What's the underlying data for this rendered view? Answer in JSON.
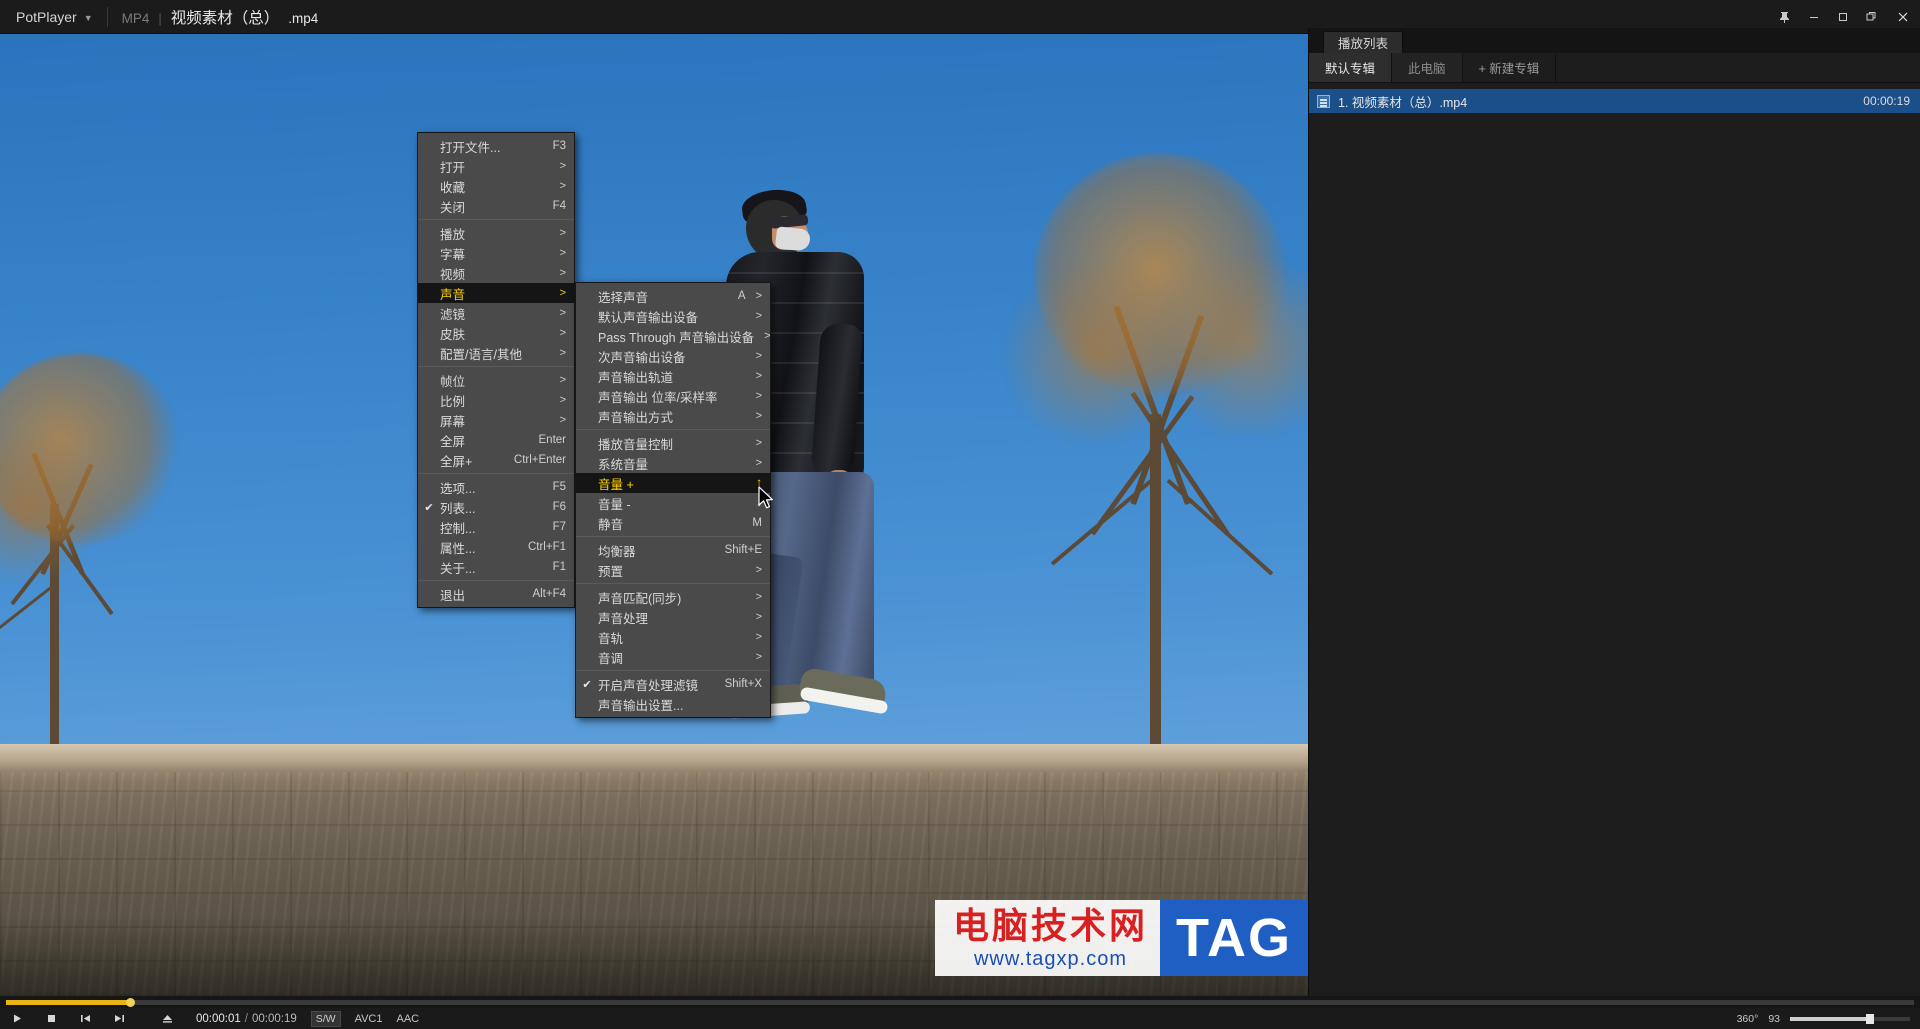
{
  "titlebar": {
    "brand": "PotPlayer",
    "caret_icon": "chevron-down-icon",
    "format": "MP4",
    "divider": "|",
    "filename": "视频素材（总）",
    "extension": ".mp4",
    "buttons": [
      {
        "name": "pin-on-top-button",
        "glyph": "pin"
      },
      {
        "name": "minimize-button",
        "glyph": "minimize"
      },
      {
        "name": "maximize-button",
        "glyph": "maximize"
      },
      {
        "name": "restore-button",
        "glyph": "restore"
      },
      {
        "name": "close-button",
        "glyph": "close"
      }
    ]
  },
  "playlist": {
    "tab": "播放列表",
    "subtabs": [
      {
        "label": "默认专辑",
        "active": true
      },
      {
        "label": "此电脑",
        "active": false
      },
      {
        "label": "+ 新建专辑",
        "active": false
      }
    ],
    "items": [
      {
        "index_title": "1. 视频素材（总）.mp4",
        "duration": "00:00:19",
        "icon": "video-file-icon"
      }
    ]
  },
  "menu_main": {
    "name": "main-context-menu",
    "items": [
      {
        "label": "打开文件...",
        "accel": "F3",
        "arrow": false,
        "checked": false,
        "highlight": false
      },
      {
        "label": "打开",
        "accel": "",
        "arrow": true,
        "checked": false,
        "highlight": false
      },
      {
        "label": "收藏",
        "accel": "",
        "arrow": true,
        "checked": false,
        "highlight": false
      },
      {
        "label": "关闭",
        "accel": "F4",
        "arrow": false,
        "checked": false,
        "highlight": false
      },
      {
        "separator": true
      },
      {
        "label": "播放",
        "accel": "",
        "arrow": true,
        "checked": false,
        "highlight": false
      },
      {
        "label": "字幕",
        "accel": "",
        "arrow": true,
        "checked": false,
        "highlight": false
      },
      {
        "label": "视频",
        "accel": "",
        "arrow": true,
        "checked": false,
        "highlight": false
      },
      {
        "label": "声音",
        "accel": "",
        "arrow": true,
        "checked": false,
        "highlight": true
      },
      {
        "label": "滤镜",
        "accel": "",
        "arrow": true,
        "checked": false,
        "highlight": false
      },
      {
        "label": "皮肤",
        "accel": "",
        "arrow": true,
        "checked": false,
        "highlight": false
      },
      {
        "label": "配置/语言/其他",
        "accel": "",
        "arrow": true,
        "checked": false,
        "highlight": false
      },
      {
        "separator": true
      },
      {
        "label": "帧位",
        "accel": "",
        "arrow": true,
        "checked": false,
        "highlight": false
      },
      {
        "label": "比例",
        "accel": "",
        "arrow": true,
        "checked": false,
        "highlight": false
      },
      {
        "label": "屏幕",
        "accel": "",
        "arrow": true,
        "checked": false,
        "highlight": false
      },
      {
        "label": "全屏",
        "accel": "Enter",
        "arrow": false,
        "checked": false,
        "highlight": false
      },
      {
        "label": "全屏+",
        "accel": "Ctrl+Enter",
        "arrow": false,
        "checked": false,
        "highlight": false
      },
      {
        "separator": true
      },
      {
        "label": "选项...",
        "accel": "F5",
        "arrow": false,
        "checked": false,
        "highlight": false
      },
      {
        "label": "列表...",
        "accel": "F6",
        "arrow": false,
        "checked": true,
        "highlight": false
      },
      {
        "label": "控制...",
        "accel": "F7",
        "arrow": false,
        "checked": false,
        "highlight": false
      },
      {
        "label": "属性...",
        "accel": "Ctrl+F1",
        "arrow": false,
        "checked": false,
        "highlight": false
      },
      {
        "label": "关于...",
        "accel": "F1",
        "arrow": false,
        "checked": false,
        "highlight": false
      },
      {
        "separator": true
      },
      {
        "label": "退出",
        "accel": "Alt+F4",
        "arrow": false,
        "checked": false,
        "highlight": false
      }
    ]
  },
  "menu_sub": {
    "name": "audio-submenu",
    "items": [
      {
        "label": "选择声音",
        "accel": "A",
        "arrow": true,
        "checked": false,
        "highlight": false
      },
      {
        "label": "默认声音输出设备",
        "accel": "",
        "arrow": true,
        "checked": false,
        "highlight": false
      },
      {
        "label": "Pass Through 声音输出设备",
        "accel": "",
        "arrow": true,
        "checked": false,
        "highlight": false
      },
      {
        "label": "次声音输出设备",
        "accel": "",
        "arrow": true,
        "checked": false,
        "highlight": false
      },
      {
        "label": "声音输出轨道",
        "accel": "",
        "arrow": true,
        "checked": false,
        "highlight": false
      },
      {
        "label": "声音输出 位率/采样率",
        "accel": "",
        "arrow": true,
        "checked": false,
        "highlight": false
      },
      {
        "label": "声音输出方式",
        "accel": "",
        "arrow": true,
        "checked": false,
        "highlight": false
      },
      {
        "separator": true
      },
      {
        "label": "播放音量控制",
        "accel": "",
        "arrow": true,
        "checked": false,
        "highlight": false
      },
      {
        "label": "系统音量",
        "accel": "",
        "arrow": true,
        "checked": false,
        "highlight": false
      },
      {
        "label": "音量 +",
        "accel": "↑",
        "arrow": false,
        "checked": false,
        "highlight": true
      },
      {
        "label": "音量 -",
        "accel": "↓",
        "arrow": false,
        "checked": false,
        "highlight": false
      },
      {
        "label": "静音",
        "accel": "M",
        "arrow": false,
        "checked": false,
        "highlight": false
      },
      {
        "separator": true
      },
      {
        "label": "均衡器",
        "accel": "Shift+E",
        "arrow": false,
        "checked": false,
        "highlight": false
      },
      {
        "label": "预置",
        "accel": "",
        "arrow": true,
        "checked": false,
        "highlight": false
      },
      {
        "separator": true
      },
      {
        "label": "声音匹配(同步)",
        "accel": "",
        "arrow": true,
        "checked": false,
        "highlight": false
      },
      {
        "label": "声音处理",
        "accel": "",
        "arrow": true,
        "checked": false,
        "highlight": false
      },
      {
        "label": "音轨",
        "accel": "",
        "arrow": true,
        "checked": false,
        "highlight": false
      },
      {
        "label": "音调",
        "accel": "",
        "arrow": true,
        "checked": false,
        "highlight": false
      },
      {
        "separator": true
      },
      {
        "label": "开启声音处理滤镜",
        "accel": "Shift+X",
        "arrow": false,
        "checked": true,
        "highlight": false
      },
      {
        "label": "声音输出设置...",
        "accel": "",
        "arrow": false,
        "checked": false,
        "highlight": false
      }
    ]
  },
  "controls": {
    "buttons": [
      {
        "name": "play-button",
        "glyph": "play"
      },
      {
        "name": "stop-button",
        "glyph": "stop"
      },
      {
        "name": "previous-button",
        "glyph": "prev"
      },
      {
        "name": "next-button",
        "glyph": "next"
      },
      {
        "name": "eject-button",
        "glyph": "eject"
      }
    ],
    "current_time": "00:00:01",
    "separator": "/",
    "total_time": "00:00:19",
    "hw_tag": "S/W",
    "video_codec": "AVC1",
    "audio_codec": "AAC",
    "rotation": "360°",
    "volume_value": "93",
    "volume_percent": 66
  },
  "seek": {
    "progress_percent": 6.5
  },
  "watermark": {
    "title": "电脑技术网",
    "subtitle": "www.tagxp.com",
    "badge": "TAG"
  },
  "colors": {
    "menu_bg": "#4a4a4a",
    "menu_highlight_bg": "#151515",
    "menu_highlight_text": "#ffd400",
    "seek_accent": "#e9b313",
    "playlist_selected": "#1b4f8a",
    "watermark_red": "#d92020",
    "watermark_blue": "#1f5fc4"
  }
}
